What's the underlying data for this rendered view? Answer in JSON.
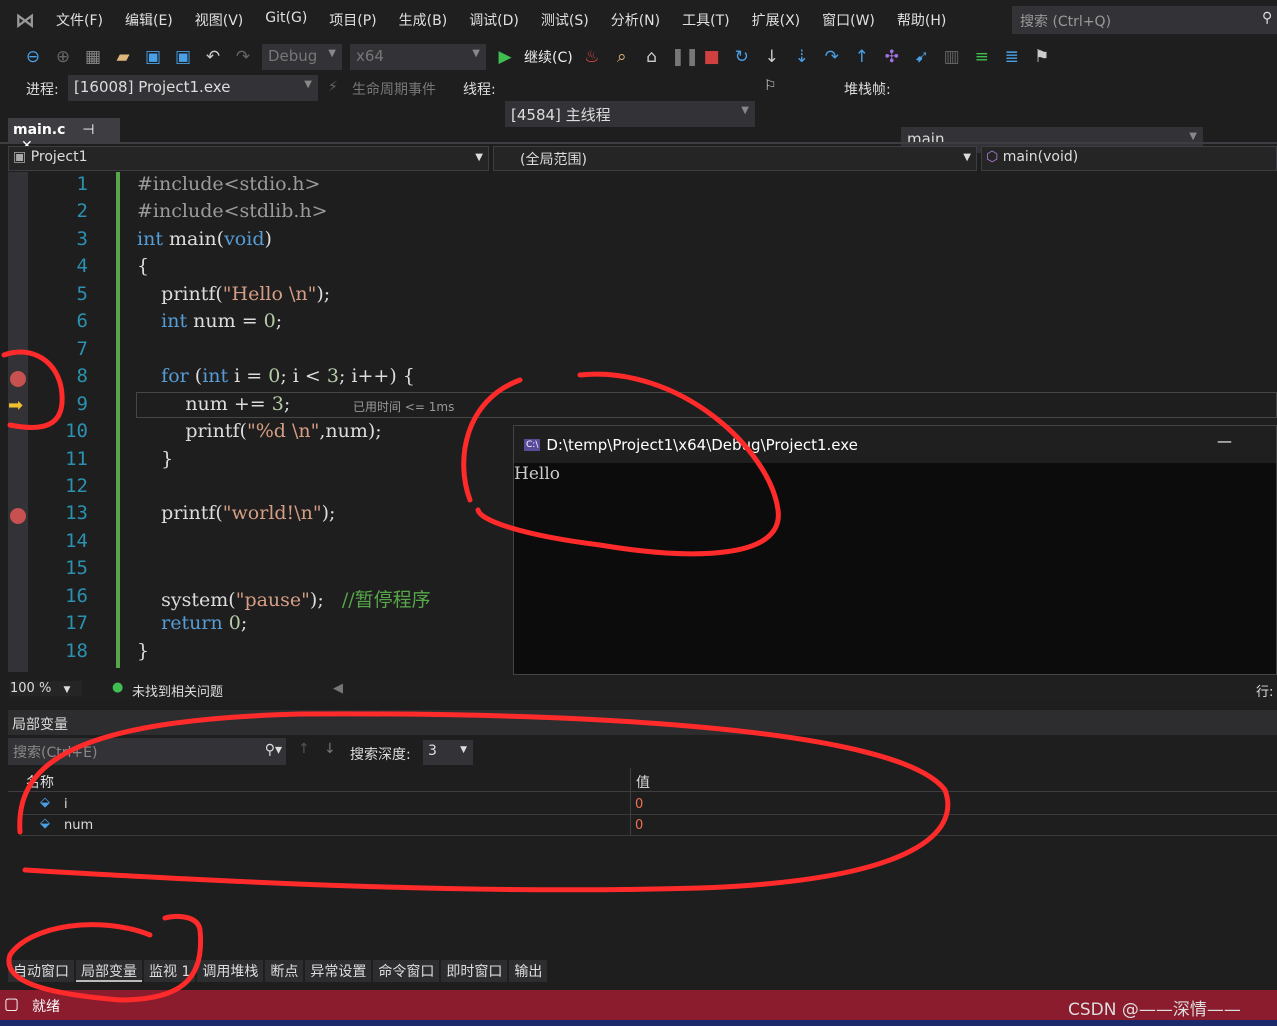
{
  "menu": [
    "文件(F)",
    "编辑(E)",
    "视图(V)",
    "Git(G)",
    "项目(P)",
    "生成(B)",
    "调试(D)",
    "测试(S)",
    "分析(N)",
    "工具(T)",
    "扩展(X)",
    "窗口(W)",
    "帮助(H)"
  ],
  "search_placeholder": "搜索 (Ctrl+Q)",
  "toolbar": {
    "config": "Debug",
    "platform": "x64",
    "continue": "继续(C)"
  },
  "toolbar2": {
    "process_label": "进程:",
    "process": "[16008] Project1.exe",
    "lifecycle": "生命周期事件",
    "thread_label": "线程:",
    "thread": "[4584] 主线程",
    "stackframe_label": "堆栈帧:",
    "stackframe": "main"
  },
  "tab": {
    "name": "main.c",
    "pin": "⊣",
    "close": "✕"
  },
  "nav": {
    "project": "Project1",
    "scope": "(全局范围)",
    "member": "main(void)"
  },
  "code": [
    [
      [
        "p",
        "#include<stdio.h>"
      ]
    ],
    [
      [
        "p",
        "#include<stdlib.h>"
      ]
    ],
    [
      [
        "k",
        "int"
      ],
      [
        "t",
        " main("
      ],
      [
        "k",
        "void"
      ],
      [
        "t",
        ")"
      ]
    ],
    [
      [
        "t",
        "{"
      ]
    ],
    [
      [
        "t",
        "    printf("
      ],
      [
        "s",
        "\"Hello \\n\""
      ],
      [
        "t",
        ");"
      ]
    ],
    [
      [
        "t",
        "    "
      ],
      [
        "k",
        "int"
      ],
      [
        "t",
        " num = "
      ],
      [
        "n",
        "0"
      ],
      [
        "t",
        ";"
      ]
    ],
    [
      [
        "t",
        ""
      ]
    ],
    [
      [
        "t",
        "    "
      ],
      [
        "k",
        "for"
      ],
      [
        "t",
        " ("
      ],
      [
        "k",
        "int"
      ],
      [
        "t",
        " i = "
      ],
      [
        "n",
        "0"
      ],
      [
        "t",
        "; i < "
      ],
      [
        "n",
        "3"
      ],
      [
        "t",
        "; i++) {"
      ]
    ],
    [
      [
        "t",
        "        num += "
      ],
      [
        "n",
        "3"
      ],
      [
        "t",
        ";"
      ]
    ],
    [
      [
        "t",
        "        printf("
      ],
      [
        "s",
        "\"%d \\n\""
      ],
      [
        "t",
        ",num);"
      ]
    ],
    [
      [
        "t",
        "    }"
      ]
    ],
    [
      [
        "t",
        ""
      ]
    ],
    [
      [
        "t",
        "    printf("
      ],
      [
        "s",
        "\"world!\\n\""
      ],
      [
        "t",
        ");"
      ]
    ],
    [
      [
        "t",
        ""
      ]
    ],
    [
      [
        "t",
        ""
      ]
    ],
    [
      [
        "t",
        "    system("
      ],
      [
        "s",
        "\"pause\""
      ],
      [
        "t",
        ");   "
      ],
      [
        "c",
        "//暂停程序"
      ]
    ],
    [
      [
        "t",
        "    "
      ],
      [
        "k",
        "return"
      ],
      [
        "t",
        " "
      ],
      [
        "n",
        "0"
      ],
      [
        "t",
        ";"
      ]
    ],
    [
      [
        "t",
        "}"
      ]
    ]
  ],
  "line_numbers": [
    "1",
    "2",
    "3",
    "4",
    "5",
    "6",
    "7",
    "8",
    "9",
    "10",
    "11",
    "12",
    "13",
    "14",
    "15",
    "16",
    "17",
    "18"
  ],
  "breakpoint_lines": [
    8,
    13
  ],
  "current_line": 9,
  "elapsed_hint": "已用时间 <= 1ms",
  "console": {
    "title": "D:\\temp\\Project1\\x64\\Debug\\Project1.exe",
    "output": "Hello",
    "minimize": "—"
  },
  "editor_status": {
    "zoom": "100 %",
    "issues": "未找到相关问题",
    "line_label": "行:"
  },
  "locals": {
    "title": "局部变量",
    "search_placeholder": "搜索(Ctrl+E)",
    "depth_label": "搜索深度:",
    "depth": "3",
    "col_name": "名称",
    "col_value": "值",
    "rows": [
      {
        "name": "i",
        "value": "0"
      },
      {
        "name": "num",
        "value": "0"
      }
    ]
  },
  "bottom_tabs": [
    "自动窗口",
    "局部变量",
    "监视 1",
    "调用堆栈",
    "断点",
    "异常设置",
    "命令窗口",
    "即时窗口",
    "输出"
  ],
  "active_bottom_tab": "局部变量",
  "status": {
    "text": "就绪",
    "watermark": "CSDN @——深情——"
  },
  "colors": {
    "keyword": "#569cd6",
    "string": "#d69d85",
    "number": "#b5cea8",
    "comment": "#57a64a",
    "preproc": "#9b9b9b",
    "status_bar": "#8a1c2e",
    "annotation": "#ff2a2a"
  }
}
